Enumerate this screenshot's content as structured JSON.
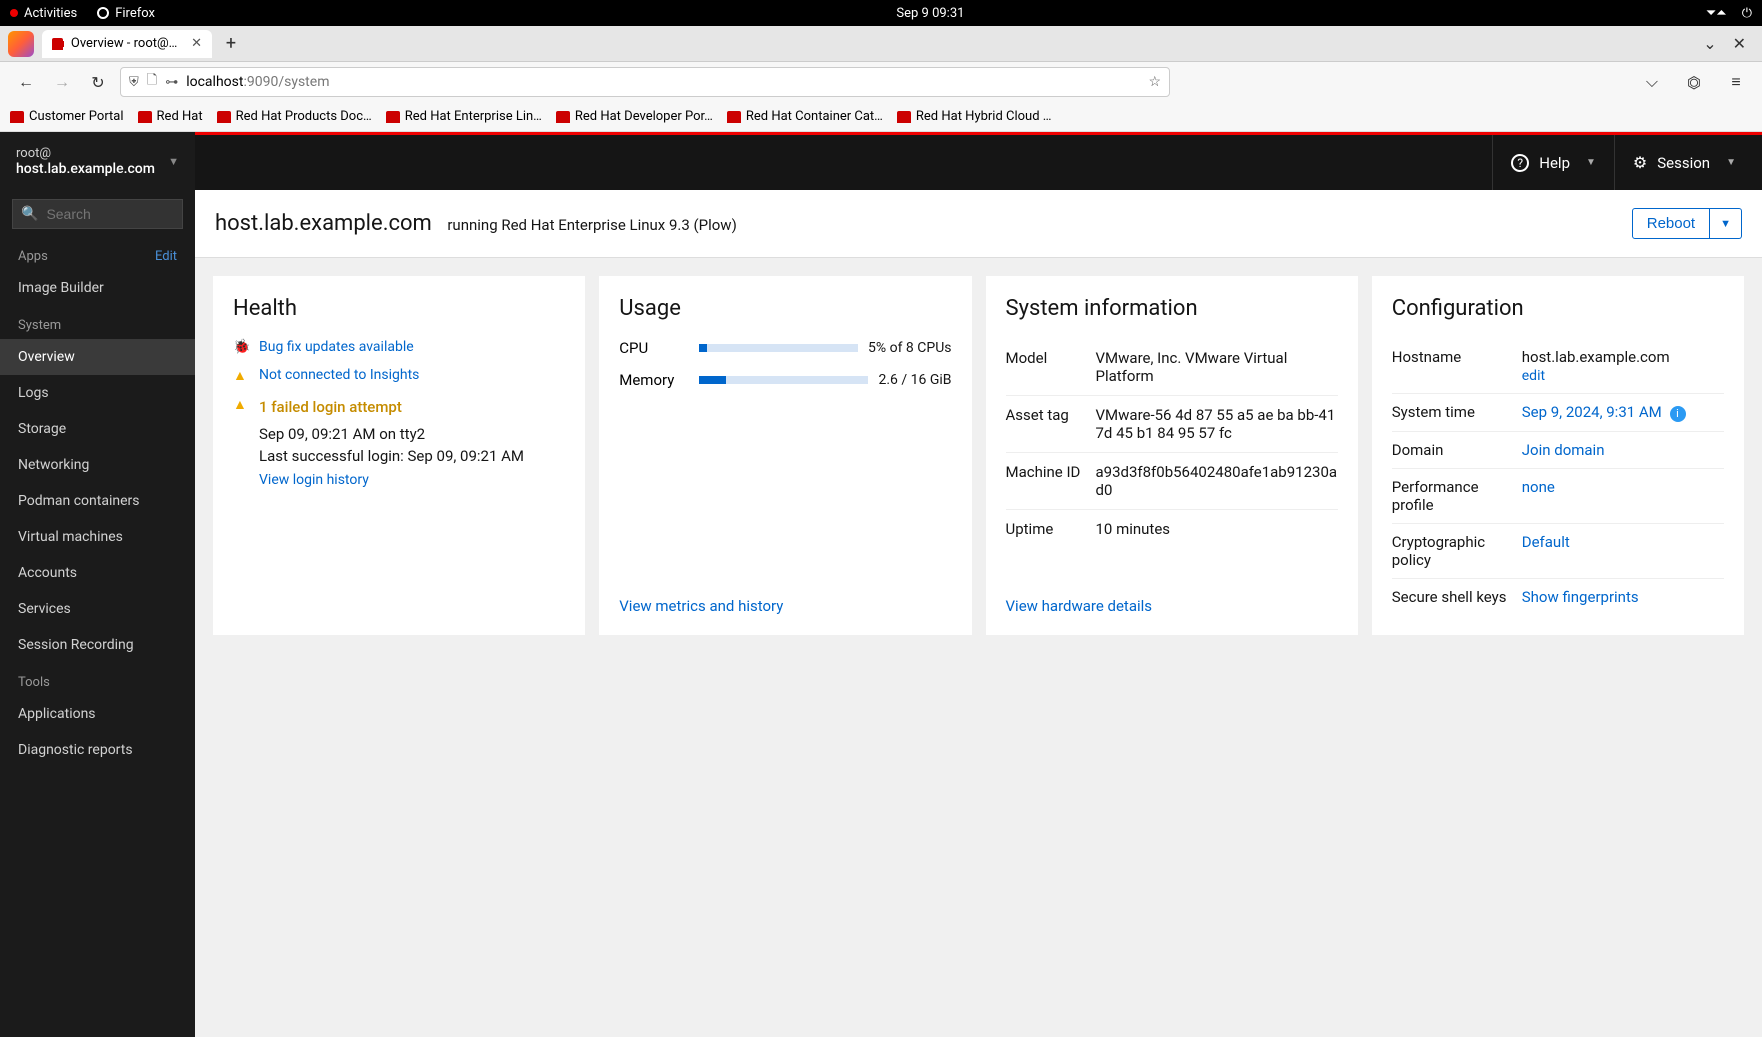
{
  "os_bar": {
    "activities": "Activities",
    "firefox": "Firefox",
    "clock": "Sep 9  09:31"
  },
  "browser": {
    "tab_title": "Overview - root@host.lab",
    "url_host": "localhost",
    "url_path": ":9090/system",
    "bookmarks": [
      "Customer Portal",
      "Red Hat",
      "Red Hat Products Doc…",
      "Red Hat Enterprise Lin…",
      "Red Hat Developer Por…",
      "Red Hat Container Cat…",
      "Red Hat Hybrid Cloud …"
    ]
  },
  "sidebar": {
    "user": "root@",
    "host": "host.lab.example.com",
    "search_placeholder": "Search",
    "sections": {
      "apps": {
        "label": "Apps",
        "edit": "Edit",
        "items": [
          "Image Builder"
        ]
      },
      "system": {
        "label": "System",
        "items": [
          "Overview",
          "Logs",
          "Storage",
          "Networking",
          "Podman containers",
          "Virtual machines",
          "Accounts",
          "Services",
          "Session Recording"
        ]
      },
      "tools": {
        "label": "Tools",
        "items": [
          "Applications",
          "Diagnostic reports"
        ]
      }
    },
    "active": "Overview"
  },
  "topbar": {
    "help": "Help",
    "session": "Session"
  },
  "page": {
    "host": "host.lab.example.com",
    "subtitle": "running Red Hat Enterprise Linux 9.3 (Plow)",
    "reboot": "Reboot"
  },
  "health": {
    "title": "Health",
    "bugfix": "Bug fix updates available",
    "insights": "Not connected to Insights",
    "failed_login": "1 failed login attempt",
    "failed_detail1": "Sep 09, 09:21 AM on tty2",
    "failed_detail2": "Last successful login: Sep 09, 09:21 AM",
    "view_history": "View login history"
  },
  "usage": {
    "title": "Usage",
    "cpu_label": "CPU",
    "cpu_text": "5% of 8 CPUs",
    "cpu_pct": 5,
    "mem_label": "Memory",
    "mem_text": "2.6 / 16 GiB",
    "mem_pct": 16,
    "link": "View metrics and history"
  },
  "sysinfo": {
    "title": "System information",
    "rows": [
      {
        "label": "Model",
        "value": "VMware, Inc. VMware Virtual Platform"
      },
      {
        "label": "Asset tag",
        "value": "VMware-56 4d 87 55 a5 ae ba bb-41 7d 45 b1 84 95 57 fc"
      },
      {
        "label": "Machine ID",
        "value": "a93d3f8f0b56402480afe1ab91230ad0"
      },
      {
        "label": "Uptime",
        "value": "10 minutes"
      }
    ],
    "link": "View hardware details"
  },
  "config": {
    "title": "Configuration",
    "hostname_label": "Hostname",
    "hostname_value": "host.lab.example.com",
    "hostname_edit": "edit",
    "systime_label": "System time",
    "systime_value": "Sep 9, 2024, 9:31 AM",
    "domain_label": "Domain",
    "domain_value": "Join domain",
    "perf_label": "Performance profile",
    "perf_value": "none",
    "crypto_label": "Cryptographic policy",
    "crypto_value": "Default",
    "ssh_label": "Secure shell keys",
    "ssh_value": "Show fingerprints"
  }
}
